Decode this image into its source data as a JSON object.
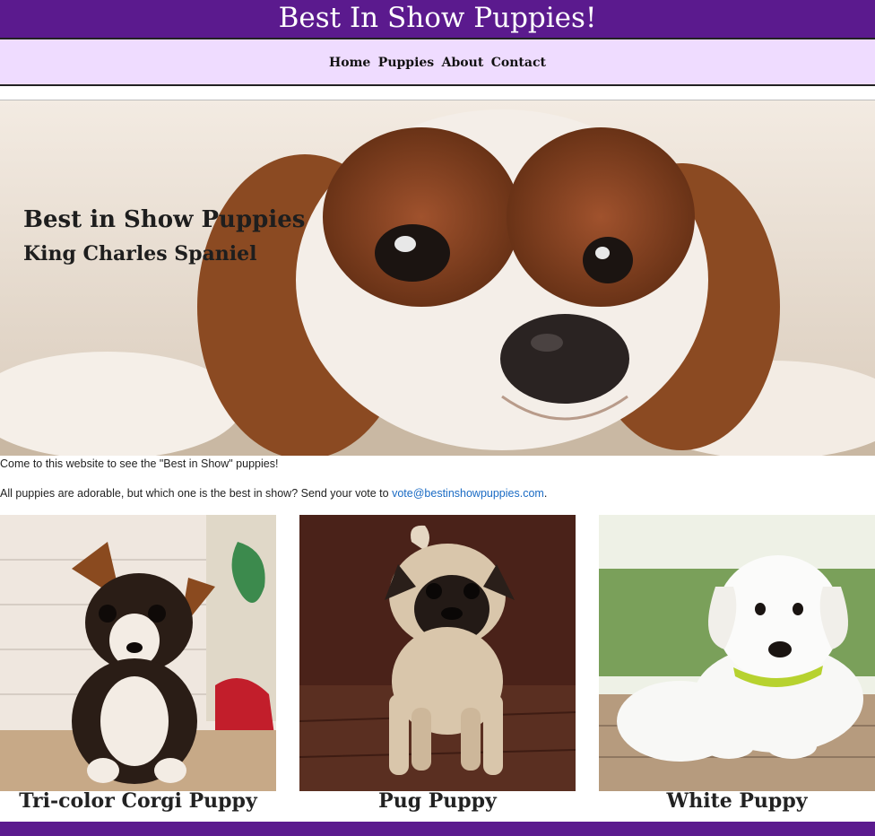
{
  "header": {
    "title": "Best In Show Puppies!"
  },
  "nav": {
    "items": [
      {
        "label": "Home"
      },
      {
        "label": "Puppies"
      },
      {
        "label": "About"
      },
      {
        "label": "Contact"
      }
    ]
  },
  "hero": {
    "title": "Best in Show Puppies",
    "subtitle": "King Charles Spaniel"
  },
  "intro_text": "Come to this website to see the \"Best in Show\" puppies!",
  "vote": {
    "text": "All puppies are adorable, but which one is the best in show? Send your vote to ",
    "email": "vote@bestinshowpuppies.com",
    "suffix": "."
  },
  "gallery": [
    {
      "caption": "Tri-color Corgi Puppy"
    },
    {
      "caption": "Pug Puppy"
    },
    {
      "caption": "White Puppy"
    }
  ],
  "colors": {
    "brand": "#5b1a8e",
    "nav_bg": "#efdcff",
    "link": "#1a6bc4"
  }
}
